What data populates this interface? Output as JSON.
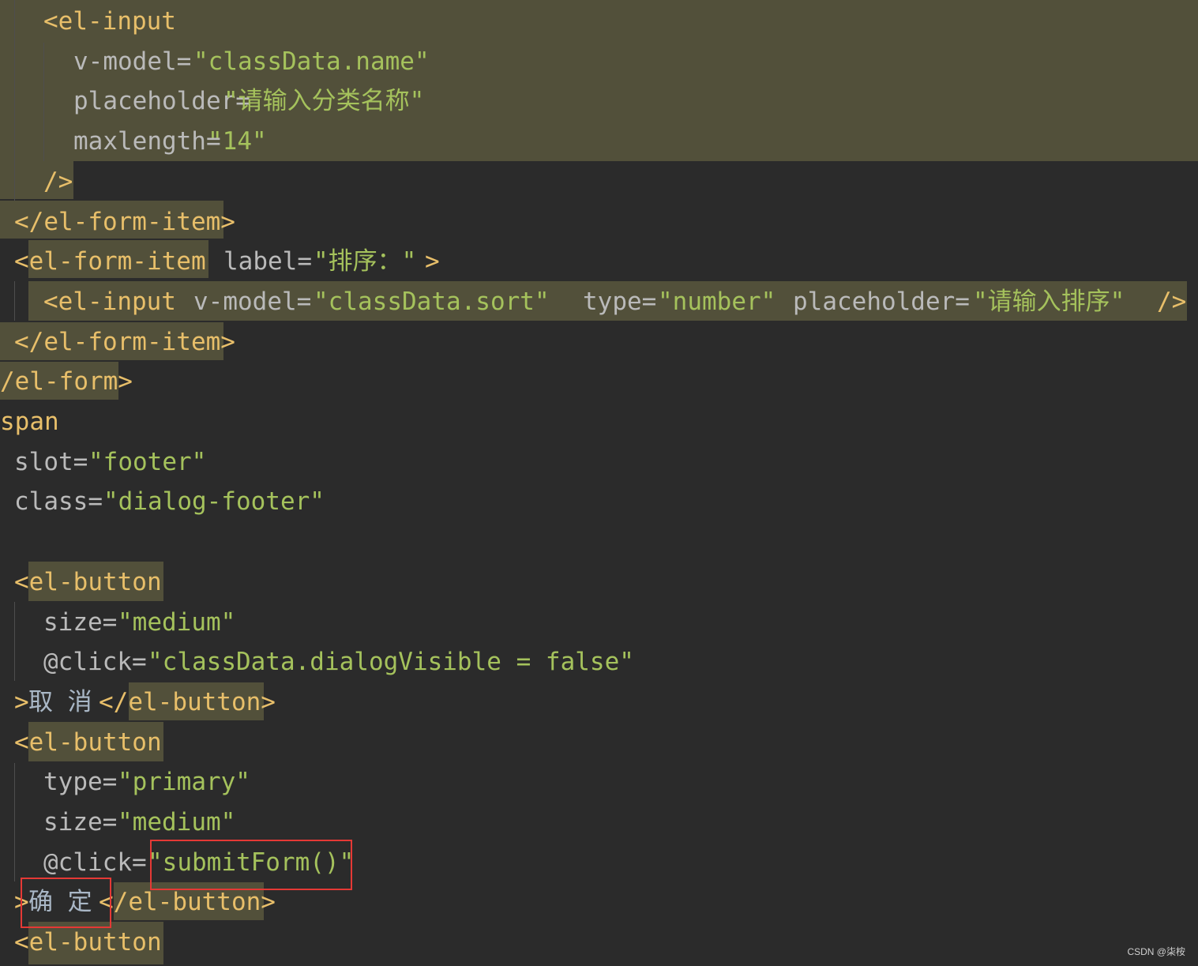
{
  "editor": {
    "lines": [
      {
        "tokens": [
          {
            "cls": "tag",
            "text": "<el-input"
          }
        ]
      },
      {
        "tokens": [
          {
            "cls": "attr",
            "text": "v-model="
          },
          {
            "cls": "str",
            "text": "\"classData.name\""
          }
        ]
      },
      {
        "tokens": [
          {
            "cls": "attr",
            "text": "placeholder="
          },
          {
            "cls": "str",
            "text": "\"请输入分类名称\""
          }
        ]
      },
      {
        "tokens": [
          {
            "cls": "attr",
            "text": "maxlength="
          },
          {
            "cls": "str",
            "text": "\"14\""
          }
        ]
      },
      {
        "tokens": [
          {
            "cls": "tag",
            "text": "/>"
          }
        ]
      },
      {
        "tokens": [
          {
            "cls": "tag",
            "text": "</el-form-item>"
          }
        ]
      },
      {
        "tokens": [
          {
            "cls": "tag",
            "text": "<el-form-item"
          },
          {
            "cls": "attr",
            "text": "label="
          },
          {
            "cls": "str",
            "text": "\"排序：\""
          },
          {
            "cls": "tag",
            "text": ">"
          }
        ]
      },
      {
        "tokens": [
          {
            "cls": "tag",
            "text": "<el-input"
          },
          {
            "cls": "attr",
            "text": "v-model="
          },
          {
            "cls": "str",
            "text": "\"classData.sort\""
          },
          {
            "cls": "attr",
            "text": "type="
          },
          {
            "cls": "str",
            "text": "\"number\""
          },
          {
            "cls": "attr",
            "text": "placeholder="
          },
          {
            "cls": "str",
            "text": "\"请输入排序\""
          },
          {
            "cls": "tag",
            "text": "/>"
          }
        ]
      },
      {
        "tokens": [
          {
            "cls": "tag",
            "text": "</el-form-item>"
          }
        ]
      },
      {
        "tokens": [
          {
            "cls": "tag",
            "text": "/el-form>"
          }
        ]
      },
      {
        "tokens": [
          {
            "cls": "tag",
            "text": "span"
          }
        ]
      },
      {
        "tokens": [
          {
            "cls": "attr",
            "text": "slot="
          },
          {
            "cls": "str",
            "text": "\"footer\""
          }
        ]
      },
      {
        "tokens": [
          {
            "cls": "attr",
            "text": "class="
          },
          {
            "cls": "str",
            "text": "\"dialog-footer\""
          }
        ]
      },
      {
        "tokens": []
      },
      {
        "tokens": [
          {
            "cls": "tag",
            "text": "<el-button"
          }
        ]
      },
      {
        "tokens": [
          {
            "cls": "attr",
            "text": "size="
          },
          {
            "cls": "str",
            "text": "\"medium\""
          }
        ]
      },
      {
        "tokens": [
          {
            "cls": "attr",
            "text": "@click="
          },
          {
            "cls": "str",
            "text": "\"classData.dialogVisible = false\""
          }
        ]
      },
      {
        "tokens": [
          {
            "cls": "tag",
            "text": ">"
          },
          {
            "cls": "txt",
            "text": "取 消"
          },
          {
            "cls": "tag",
            "text": "</el-button>"
          }
        ]
      },
      {
        "tokens": [
          {
            "cls": "tag",
            "text": "<el-button"
          }
        ]
      },
      {
        "tokens": [
          {
            "cls": "attr",
            "text": "type="
          },
          {
            "cls": "str",
            "text": "\"primary\""
          }
        ]
      },
      {
        "tokens": [
          {
            "cls": "attr",
            "text": "size="
          },
          {
            "cls": "str",
            "text": "\"medium\""
          }
        ]
      },
      {
        "tokens": [
          {
            "cls": "attr",
            "text": "@click="
          },
          {
            "cls": "str",
            "text": "\"submitForm()\""
          }
        ]
      },
      {
        "tokens": [
          {
            "cls": "tag",
            "text": ">"
          },
          {
            "cls": "txt",
            "text": "确 定"
          },
          {
            "cls": "tag",
            "text": "</el-button>"
          }
        ]
      },
      {
        "tokens": [
          {
            "cls": "tag",
            "text": "<el-button"
          }
        ]
      }
    ]
  },
  "watermark": "CSDN @柒桉",
  "colors": {
    "background": "#2b2b2b",
    "highlight": "#52503a",
    "tag": "#e8bf6a",
    "attribute": "#bababa",
    "string": "#a5c25c",
    "annotation_box": "#e53935"
  }
}
